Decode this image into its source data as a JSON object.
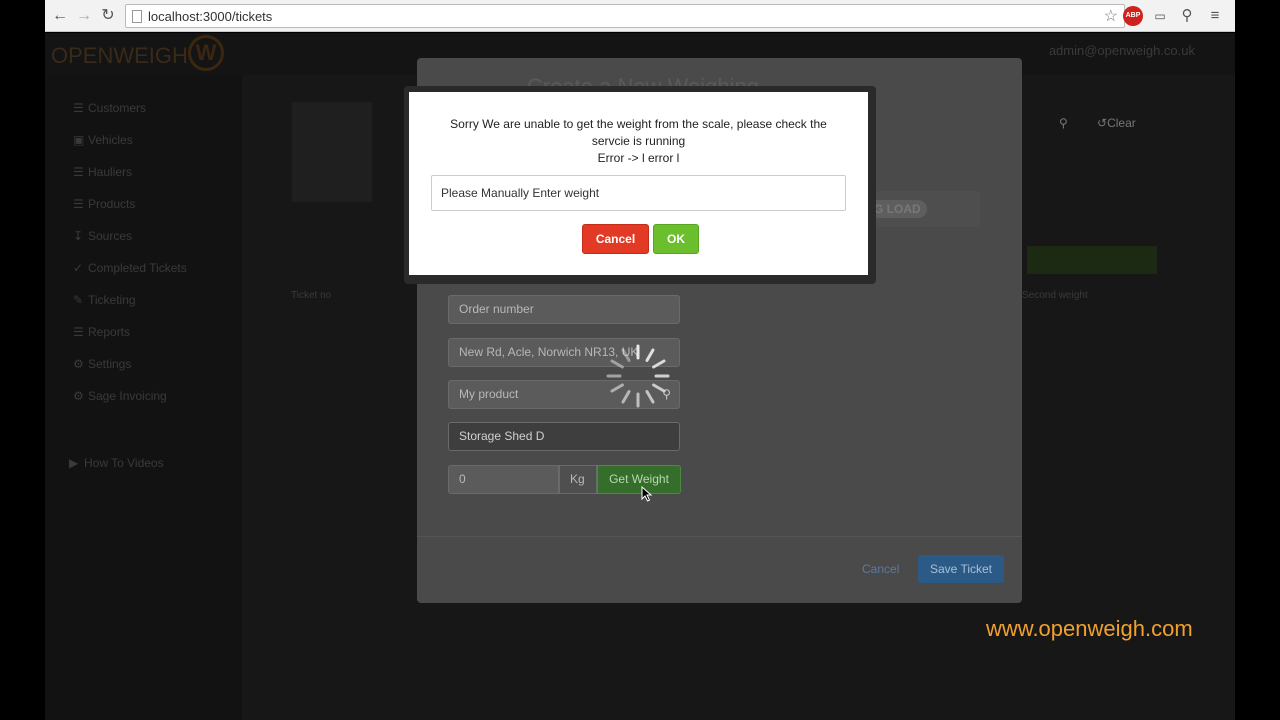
{
  "browser": {
    "url": "localhost:3000/tickets",
    "back_icon": "arrow-left-icon",
    "forward_icon": "arrow-right-icon",
    "reload_icon": "reload-icon",
    "abp_label": "ABP"
  },
  "app": {
    "logo_text": "OPENWEIGH",
    "logo_mark": "W",
    "user": "admin@openweigh.co.uk",
    "sidebar": [
      {
        "label": "Customers"
      },
      {
        "label": "Vehicles"
      },
      {
        "label": "Hauliers"
      },
      {
        "label": "Products"
      },
      {
        "label": "Sources"
      },
      {
        "label": "Completed Tickets"
      },
      {
        "label": "Ticketing"
      },
      {
        "label": "Reports"
      },
      {
        "label": "Settings"
      },
      {
        "label": "Sage Invoicing"
      },
      {
        "label": "How To Videos"
      }
    ]
  },
  "ticket_modal": {
    "title": "Create a New Weighing",
    "order_placeholder": "Order number",
    "address_value": "New Rd, Acle, Norwich NR13, UK",
    "product_value": "My product",
    "storage_value": "Storage Shed D",
    "weight_value": "0",
    "weight_unit": "Kg",
    "get_weight_label": "Get Weight",
    "cancel_label": "Cancel",
    "save_label": "Save Ticket"
  },
  "background": {
    "col_ticket_no": "Ticket no",
    "col_second_weight": "Second weight",
    "clear_label": "Clear",
    "load_label": "G LOAD"
  },
  "alert": {
    "line1": "Sorry We are unable to get the weight from the scale, please check the",
    "line2": "servcie is running",
    "line3": "Error -> l error l",
    "input_value": "Please Manually Enter weight",
    "cancel_label": "Cancel",
    "ok_label": "OK",
    "cancel_color": "#e23a25",
    "ok_color": "#6cbf2c"
  },
  "watermark": "www.openweigh.com"
}
